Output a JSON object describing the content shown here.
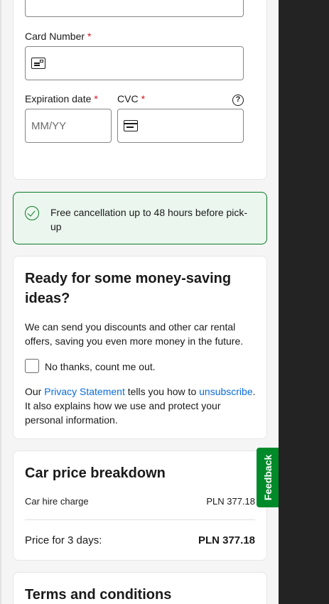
{
  "payment": {
    "card_number_label": "Card Number",
    "required_mark": "*",
    "expiration_label": "Expiration date",
    "expiration_placeholder": "MM/YY",
    "cvc_label": "CVC",
    "help_glyph": "?"
  },
  "notice": {
    "text": "Free cancellation up to 48 hours before pick-up",
    "icon": "check-circle-icon",
    "color": "#0d7a27"
  },
  "marketing": {
    "title": "Ready for some money-saving ideas?",
    "description": "We can send you discounts and other car rental offers, saving you even more money in the future.",
    "opt_out_label": "No thanks, count me out.",
    "privacy_prefix": "Our ",
    "privacy_link": "Privacy Statement",
    "privacy_middle": " tells you how to ",
    "unsubscribe_link": "unsubscribe",
    "privacy_suffix": ". It also explains how we use and protect your personal information."
  },
  "breakdown": {
    "title": "Car price breakdown",
    "hire_label": "Car hire charge",
    "hire_value": "PLN 377.18",
    "total_label": "Price for 3 days:",
    "total_value": "PLN 377.18"
  },
  "terms": {
    "title": "Terms and conditions"
  },
  "feedback": {
    "label": "Feedback",
    "color": "#008a2a"
  }
}
